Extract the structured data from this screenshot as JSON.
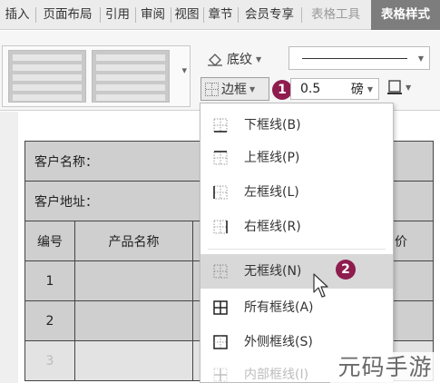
{
  "ribbon": {
    "tabs": [
      {
        "label": "插入"
      },
      {
        "label": "页面布局"
      },
      {
        "label": "引用"
      },
      {
        "label": "审阅"
      },
      {
        "label": "视图"
      },
      {
        "label": "章节"
      },
      {
        "label": "会员专享"
      },
      {
        "label": "表格工具"
      },
      {
        "label": "表格样式"
      }
    ],
    "shading_label": "底纹",
    "borders_label": "边框",
    "line_weight_value": "0.5",
    "line_weight_unit": "磅"
  },
  "callouts": {
    "step1": "1",
    "step2": "2"
  },
  "table": {
    "customer_name_label": "客户名称：",
    "customer_address_label": "客户地址：",
    "col_number": "编号",
    "col_product": "产品名称",
    "col_price_partial": "价",
    "rows": [
      "1",
      "2",
      "3"
    ]
  },
  "menu": {
    "items": [
      {
        "label": "下框线(B)",
        "icon": "bottom-border-icon"
      },
      {
        "label": "上框线(P)",
        "icon": "top-border-icon"
      },
      {
        "label": "左框线(L)",
        "icon": "left-border-icon"
      },
      {
        "label": "右框线(R)",
        "icon": "right-border-icon"
      },
      {
        "label": "无框线(N)",
        "icon": "no-border-icon"
      },
      {
        "label": "所有框线(A)",
        "icon": "all-borders-icon"
      },
      {
        "label": "外侧框线(S)",
        "icon": "outside-borders-icon"
      },
      {
        "label": "内部框线(I)",
        "icon": "inside-borders-icon"
      }
    ],
    "highlighted_index": 4
  },
  "watermark": "元码手游网",
  "colors": {
    "active_tab": "#7d7d7d",
    "badge": "#8e1d4e",
    "highlight": "#d8d8d8"
  }
}
